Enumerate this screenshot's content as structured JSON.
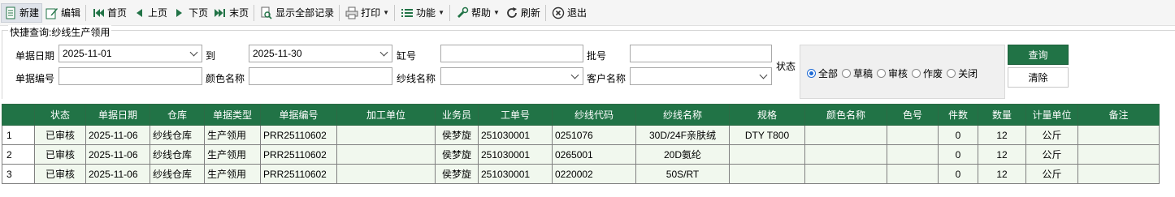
{
  "toolbar": {
    "new": "新建",
    "edit": "编辑",
    "first": "首页",
    "prev": "上页",
    "next": "下页",
    "last": "末页",
    "show_all": "显示全部记录",
    "print": "打印",
    "functions": "功能",
    "help": "帮助",
    "refresh": "刷新",
    "exit": "退出"
  },
  "query": {
    "title": "快捷查询:纱线生产领用",
    "date_label": "单据日期",
    "date_from": "2025-11-01",
    "to_label": "到",
    "date_to": "2025-11-30",
    "vat_label": "缸号",
    "vat_value": "",
    "batch_label": "批号",
    "batch_value": "",
    "docno_label": "单据编号",
    "docno_value": "",
    "color_label": "颜色名称",
    "color_value": "",
    "yarn_label": "纱线名称",
    "yarn_value": "",
    "customer_label": "客户名称",
    "customer_value": "",
    "status_label": "状态",
    "status_options": [
      "全部",
      "草稿",
      "审核",
      "作废",
      "关闭"
    ],
    "status_selected": "全部",
    "search_button": "查询",
    "clear_button": "清除"
  },
  "grid": {
    "columns": [
      "",
      "状态",
      "单据日期",
      "仓库",
      "单据类型",
      "单据编号",
      "加工单位",
      "业务员",
      "工单号",
      "纱线代码",
      "纱线名称",
      "规格",
      "颜色名称",
      "色号",
      "件数",
      "数量",
      "计量单位",
      "备注"
    ],
    "rows": [
      [
        "1",
        "已审核",
        "2025-11-06",
        "纱线仓库",
        "生产领用",
        "PRR25110602",
        "",
        "侯梦旋",
        "251030001",
        "0251076",
        "30D/24F亲肤绒",
        "DTY T800",
        "",
        "",
        "0",
        "12",
        "公斤",
        ""
      ],
      [
        "2",
        "已审核",
        "2025-11-06",
        "纱线仓库",
        "生产领用",
        "PRR25110602",
        "",
        "侯梦旋",
        "251030001",
        "0265001",
        "20D氨纶",
        "",
        "",
        "",
        "0",
        "12",
        "公斤",
        ""
      ],
      [
        "3",
        "已审核",
        "2025-11-06",
        "纱线仓库",
        "生产领用",
        "PRR25110602",
        "",
        "侯梦旋",
        "251030001",
        "0220002",
        "50S/RT",
        "",
        "",
        "",
        "0",
        "12",
        "公斤",
        ""
      ]
    ]
  },
  "colors": {
    "accent": "#217346",
    "row_bg": "#f1f8ee"
  }
}
